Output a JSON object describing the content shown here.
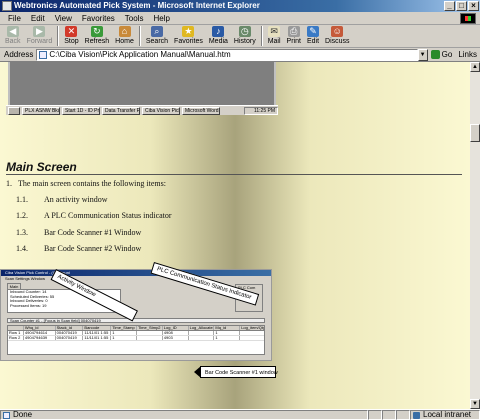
{
  "window": {
    "title": "Webtronics Automated Pick System - Microsoft Internet Explorer"
  },
  "menu": [
    "File",
    "Edit",
    "View",
    "Favorites",
    "Tools",
    "Help"
  ],
  "toolbar": {
    "buttons": [
      {
        "label": "Back",
        "icon": "back-arrow-icon",
        "disabled": true
      },
      {
        "label": "Forward",
        "icon": "forward-arrow-icon",
        "disabled": true
      },
      {
        "label": "Stop",
        "icon": "stop-icon",
        "disabled": false
      },
      {
        "label": "Refresh",
        "icon": "refresh-icon",
        "disabled": false
      },
      {
        "label": "Home",
        "icon": "home-icon",
        "disabled": false
      },
      {
        "label": "Search",
        "icon": "search-icon",
        "disabled": false
      },
      {
        "label": "Favorites",
        "icon": "favorites-icon",
        "disabled": false
      },
      {
        "label": "Media",
        "icon": "media-icon",
        "disabled": false
      },
      {
        "label": "History",
        "icon": "history-icon",
        "disabled": false
      },
      {
        "label": "Mail",
        "icon": "mail-icon",
        "disabled": false
      },
      {
        "label": "Print",
        "icon": "print-icon",
        "disabled": false
      },
      {
        "label": "Edit",
        "icon": "edit-icon",
        "disabled": false
      },
      {
        "label": "Discuss",
        "icon": "discuss-icon",
        "disabled": false
      }
    ]
  },
  "address": {
    "label": "Address",
    "value": "C:\\Ciba Vision\\Pick Application Manual\\Manual.htm",
    "go_label": "Go",
    "links_label": "Links"
  },
  "document": {
    "heading": "Main Screen",
    "intro_number": "1.",
    "intro": "The main screen contains the following items:",
    "items": [
      {
        "number": "1.1.",
        "text": "An activity window"
      },
      {
        "number": "1.2.",
        "text": "A PLC Communication Status indicator"
      },
      {
        "number": "1.3.",
        "text": "Bar Code Scanner #1  Window"
      },
      {
        "number": "1.4.",
        "text": "Bar Code Scanner #2 Window"
      }
    ],
    "screenshot_taskbar": {
      "tasks": [
        "PLX ASNW Bkup file is locke",
        "Start 1D - ID Programmer",
        "Data Transfer From SD RE",
        "Ciba Vision Pick Con",
        "Microsoft Word - Pick Ma"
      ],
      "clock": "11:25 PM"
    },
    "figure": {
      "title": "Ciba Vision Pick Control - (Communi",
      "menu": "Scan   Settings   Window",
      "tab": "Main",
      "activity_lines": [
        "Inbound Counter: 14",
        "Scheduled Deliveries: 55",
        "Inbound Deliveries: 0",
        "Processed Items: 19"
      ],
      "plc_label": "PLC Com",
      "scan_text": "Scan Counter #1 - [Focus in Scan field] 004070419",
      "table_headers": [
        "",
        "Whq_id",
        "Stack_id",
        "Barcode",
        "Time_Stamp",
        "Time_Stmp2",
        "Log_ID",
        "Log_Allocated",
        "Mq_id",
        "Log_item/Qty"
      ],
      "table_rows": [
        [
          "Row 1",
          "4904794614",
          "004070419",
          "11/11/01 1:55",
          "1",
          "",
          "4908",
          "",
          "1",
          ""
        ],
        [
          "Row 2",
          "4904794639",
          "004070419",
          "11/11/01 1:55",
          "1",
          "",
          "4903",
          "",
          "1",
          ""
        ]
      ]
    },
    "callouts": {
      "activity": "Activity Window",
      "plc": "PLC Communication Status Indicator",
      "barcode": "Bar Code Scanner #1 window"
    }
  },
  "status": {
    "text": "Done",
    "zone": "Local intranet"
  }
}
